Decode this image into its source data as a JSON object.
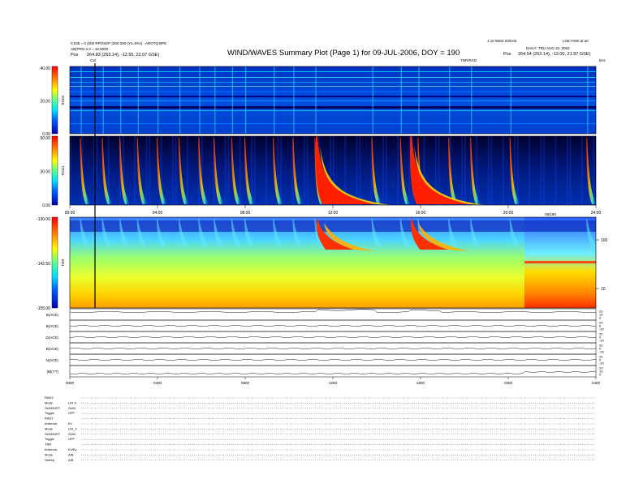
{
  "header": {
    "title": "WIND/WAVES Summary Plot (Page 1) for 09-JUL-2006, DOY = 190",
    "left_line1": "0.035 = 0 (000 RPOSEP (000 000 (Ys=0%)) - AROTQ BPE",
    "left_line2": "AB(PRO 2.3 = 10.0000",
    "left_pos_label": "Pos",
    "left_pos_value": "264.83 (263.14), -12.55, 22.07 GSE)",
    "right_line1": "1.10 WED 20/C00",
    "right_line2": "LOE F000 at a0",
    "right_line3": "DAILY: TRU AUG 22, 2002",
    "right_pos_label": "Pos",
    "right_pos_value": "264.54 (263.14), -13.00, 21.87 GSE)",
    "cal_label": "Cal",
    "top_right_label": "TNR/RAD",
    "top_right_unit": "kHz"
  },
  "colorbars": [
    {
      "label": "RAD2",
      "ticks": [
        "40.00",
        "20.00",
        "0.00"
      ]
    },
    {
      "label": "RAD1",
      "ticks": [
        "50.00",
        "30.00",
        "0.00"
      ]
    },
    {
      "label": "TNR",
      "ticks": [
        "-130.00",
        "-142.50",
        "-155.00"
      ]
    }
  ],
  "time_axis": {
    "ticks": [
      "00:00",
      "04:00",
      "08:00",
      "12:00",
      "16:00",
      "20:00",
      "24:00"
    ],
    "tnr_label": "09/190"
  },
  "tnr_right_ticks": [
    "100",
    "10"
  ],
  "line_panels": [
    {
      "label": "B(ACE)",
      "ticks": [
        "20",
        "10",
        "0"
      ]
    },
    {
      "label": "B(ACE)",
      "ticks": [
        "20",
        "0",
        "-20"
      ]
    },
    {
      "label": "Ω(ACE)",
      "ticks": [
        "20",
        "0",
        "-20"
      ]
    },
    {
      "label": "B(ACE)",
      "ticks": [
        "20",
        "0",
        "-20"
      ]
    },
    {
      "label": "N(ACE)",
      "ticks": [
        "20",
        "0",
        "-20"
      ]
    },
    {
      "label": "|B|(YT)",
      "ticks": [
        "20",
        "10",
        "0"
      ]
    }
  ],
  "bottom_axis_ticks": [
    "0000",
    "0400",
    "0800",
    "1200",
    "1600",
    "2000",
    "2400"
  ],
  "params": [
    {
      "key": "RAD2",
      "value": ""
    },
    {
      "key": "Mode",
      "value": "LIN S"
    },
    {
      "key": "SUM/DIFF",
      "value": "SUM"
    },
    {
      "key": "Toggle",
      "value": "OFF"
    },
    {
      "key": "RAD1",
      "value": ""
    },
    {
      "key": "Antenna",
      "value": "Ex"
    },
    {
      "key": "Mode",
      "value": "LIN_II"
    },
    {
      "key": "SUM/DIFF",
      "value": "SUM"
    },
    {
      "key": "Toggle",
      "value": "OFF"
    },
    {
      "key": "TNR",
      "value": ""
    },
    {
      "key": "Antenna",
      "value": "Ex/Ey"
    },
    {
      "key": "Mode",
      "value": "A/B"
    },
    {
      "key": "Sweep",
      "value": "A/B"
    }
  ],
  "chart_data": {
    "type": "heatmap",
    "title": "WIND/WAVES Summary Plot (Page 1) for 09-JUL-2006, DOY = 190",
    "x_range_hours": [
      0,
      24
    ],
    "colorscale": [
      "#00007a",
      "#0000ff",
      "#00aaff",
      "#00ffff",
      "#7fff7f",
      "#ffff00",
      "#ff8000",
      "#ff0000"
    ],
    "panels": [
      {
        "name": "RAD2",
        "z_range": [
          0,
          40
        ]
      },
      {
        "name": "RAD1",
        "z_range": [
          0,
          50
        ]
      },
      {
        "name": "TNR",
        "z_range": [
          -155,
          -130
        ]
      }
    ],
    "type_iii_burst_times_hours": [
      0.5,
      1.5,
      2.3,
      3.1,
      4.0,
      5.0,
      5.9,
      6.6,
      7.4,
      8.0,
      9.3,
      10.2,
      11.2,
      13.8,
      15.1,
      15.9,
      17.3,
      18.3,
      20.1,
      23.6
    ],
    "major_event_times_hours": [
      11.3,
      15.6
    ]
  }
}
